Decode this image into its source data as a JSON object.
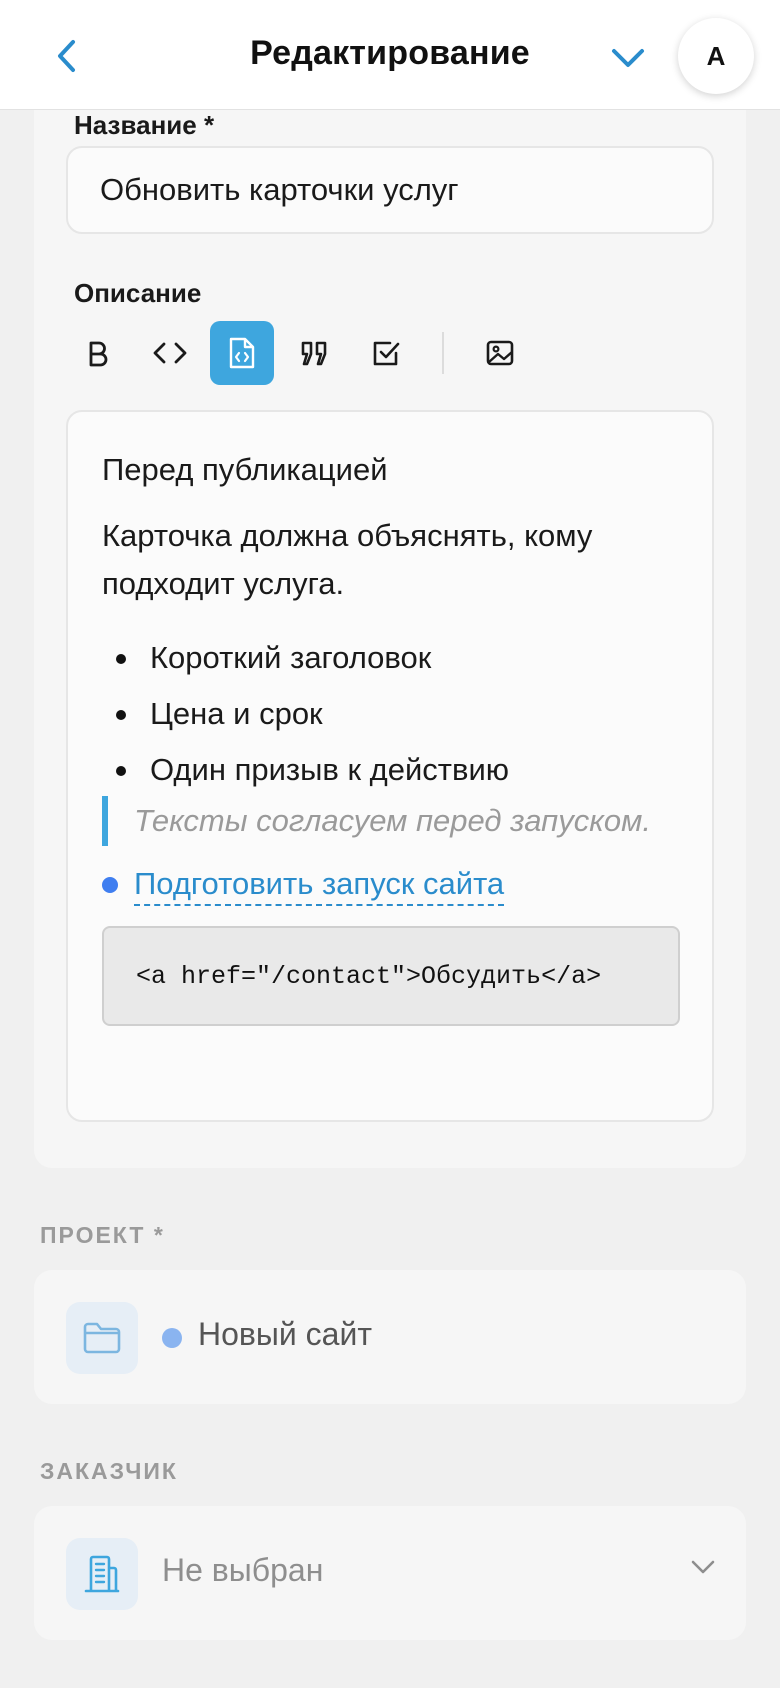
{
  "header": {
    "title": "Редактирование",
    "avatar_initial": "А"
  },
  "form": {
    "name_label": "Название *",
    "name_value": "Обновить карточки услуг",
    "description_label": "Описание",
    "toolbar": [
      "bold",
      "code-inline",
      "code-block",
      "quote",
      "checklist",
      "image"
    ],
    "toolbar_active": "code-block"
  },
  "editor": {
    "heading": "Перед публикацией",
    "paragraph": "Карточка должна объяснять, кому подходит услуга.",
    "bullets": [
      "Короткий заголовок",
      "Цена и срок",
      "Один призыв к действию"
    ],
    "quote": "Тексты согласуем перед запуском.",
    "link_text": "Подготовить запуск сайта",
    "code": "<a href=\"/contact\">Обсудить</a>"
  },
  "project": {
    "label": "ПРОЕКТ *",
    "value": "Новый сайт",
    "dot_color": "#8ab4f0"
  },
  "client": {
    "label": "ЗАКАЗЧИК",
    "value": "Не выбран"
  },
  "colors": {
    "accent": "#3ea6de",
    "link": "#2a8ccc",
    "background": "#f0f0f0"
  }
}
